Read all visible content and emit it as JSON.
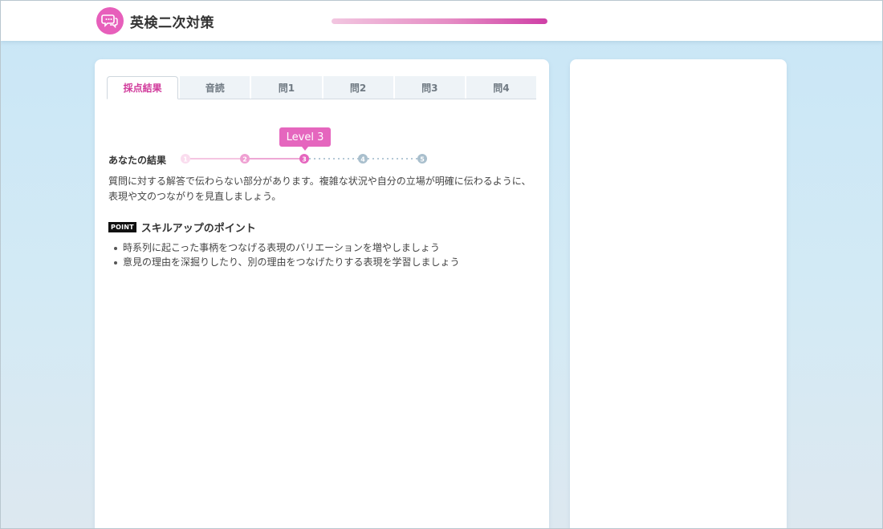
{
  "header": {
    "app_title": "英検二次対策",
    "logo_icon": "speech-bubble-icon",
    "progress": 1.0,
    "accent_color": "#e566be"
  },
  "tabs": [
    {
      "label": "採点結果",
      "active": true
    },
    {
      "label": "音読",
      "active": false
    },
    {
      "label": "問1",
      "active": false
    },
    {
      "label": "問2",
      "active": false
    },
    {
      "label": "問3",
      "active": false
    },
    {
      "label": "問4",
      "active": false
    }
  ],
  "result": {
    "label": "あなたの結果",
    "level_badge": "Level 3",
    "current_level": 3,
    "levels": [
      "1",
      "2",
      "3",
      "4",
      "5"
    ],
    "message": "質問に対する解答で伝わらない部分があります。複雑な状況や自分の立場が明確に伝わるように、表現や文のつながりを見直しましょう。"
  },
  "skill_points": {
    "badge": "POINT",
    "title": "スキルアップのポイント",
    "items": [
      "時系列に起こった事柄をつなげる表現のバリエーションを増やしましょう",
      "意見の理由を深掘りしたり、別の理由をつなげたりする表現を学習しましょう"
    ]
  }
}
